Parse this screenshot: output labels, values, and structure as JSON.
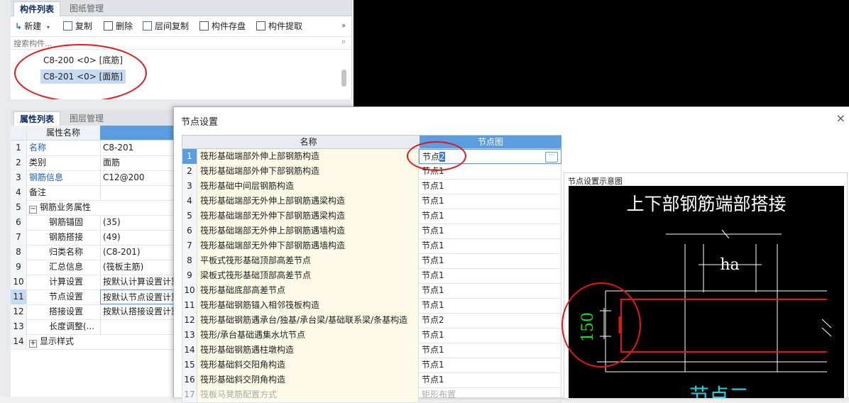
{
  "component_panel": {
    "tabs": [
      "构件列表",
      "图纸管理"
    ],
    "toolbar": [
      "新建",
      "复制",
      "删除",
      "层间复制",
      "构件存盘",
      "构件提取"
    ],
    "new_dropdown_icon": "chevron-down-icon",
    "overflow_icon": "double-chevron-right-icon",
    "search_placeholder": "搜索构件...",
    "items": [
      "C8-200 <0> [底筋]",
      "C8-201 <0> [面筋]"
    ],
    "selected_item": "C8-201 <0> [面筋]"
  },
  "property_panel": {
    "tabs": [
      "属性列表",
      "图层管理"
    ],
    "header_name": "属性名称",
    "rows": [
      {
        "num": "1",
        "name": "名称",
        "value": "C8-201"
      },
      {
        "num": "2",
        "name": "类别",
        "value": "面筋"
      },
      {
        "num": "3",
        "name": "钢筋信息",
        "value": "C12@200"
      },
      {
        "num": "4",
        "name": "备注",
        "value": ""
      },
      {
        "num": "5",
        "name": "钢筋业务属性",
        "value": ""
      },
      {
        "num": "6",
        "name": "钢筋锚固",
        "value": "(35)"
      },
      {
        "num": "7",
        "name": "钢筋搭接",
        "value": "(49)"
      },
      {
        "num": "8",
        "name": "归类名称",
        "value": "(C8-201)"
      },
      {
        "num": "9",
        "name": "汇总信息",
        "value": "(筏板主筋)"
      },
      {
        "num": "10",
        "name": "计算设置",
        "value": "按默认计算设置计算"
      },
      {
        "num": "11",
        "name": "节点设置",
        "value": "按默认节点设置计算"
      },
      {
        "num": "12",
        "name": "搭接设置",
        "value": "按默认搭接设置计算"
      },
      {
        "num": "13",
        "name": "长度调整(...",
        "value": ""
      },
      {
        "num": "14",
        "name": "显示样式",
        "value": ""
      }
    ],
    "expand_symbols": {
      "minus": "−",
      "plus": "+"
    }
  },
  "dialog": {
    "title": "节点设置",
    "close": "×",
    "columns": [
      "名称",
      "节点图"
    ],
    "rows": [
      {
        "num": "1",
        "name": "筏形基础端部外伸上部钢筋构造",
        "node": "节点2"
      },
      {
        "num": "2",
        "name": "筏形基础端部外伸下部钢筋构造",
        "node": "节点1"
      },
      {
        "num": "3",
        "name": "筏形基础中间层钢筋构造",
        "node": "节点1"
      },
      {
        "num": "4",
        "name": "筏形基础端部无外伸上部钢筋遇梁构造",
        "node": "节点1"
      },
      {
        "num": "5",
        "name": "筏形基础端部无外伸下部钢筋遇梁构造",
        "node": "节点1"
      },
      {
        "num": "6",
        "name": "筏形基础端部无外伸上部钢筋遇墙构造",
        "node": "节点1"
      },
      {
        "num": "7",
        "name": "筏形基础端部无外伸下部钢筋遇墙构造",
        "node": "节点1"
      },
      {
        "num": "8",
        "name": "平板式筏形基础顶部高差节点",
        "node": "节点1"
      },
      {
        "num": "9",
        "name": "梁板式筏形基础顶部高差节点",
        "node": "节点1"
      },
      {
        "num": "10",
        "name": "筏形基础底部高差节点",
        "node": "节点1"
      },
      {
        "num": "11",
        "name": "筏形基础钢筋锚入相邻筏板构造",
        "node": "节点1"
      },
      {
        "num": "12",
        "name": "筏形基础钢筋遇承台/独基/承台梁/基础联系梁/条基构造",
        "node": "节点2"
      },
      {
        "num": "13",
        "name": "筏形/承台基础遇集水坑节点",
        "node": "节点1"
      },
      {
        "num": "14",
        "name": "筏形基础钢筋遇柱墩构造",
        "node": "节点1"
      },
      {
        "num": "15",
        "name": "筏形基础斜交阳角构造",
        "node": "节点1"
      },
      {
        "num": "16",
        "name": "筏形基础斜交阴角构造",
        "node": "节点1"
      },
      {
        "num": "17",
        "name": "筏板马凳筋配置方式",
        "node": "矩形布置"
      }
    ],
    "first_node_highlight": "2",
    "ellipsis": "···",
    "preview_label": "节点设置示意图",
    "preview": {
      "title": "上下部钢筋端部搭接",
      "dim_ha": "ha",
      "dim_150": "150",
      "node_label": "节点二",
      "colors": {
        "bg": "#000000",
        "line": "#ffffff",
        "rebar": "#e01818",
        "dim": "#18e018",
        "label": "#18d6e0"
      }
    }
  },
  "annotations": {
    "circle_color": "#e01818"
  }
}
